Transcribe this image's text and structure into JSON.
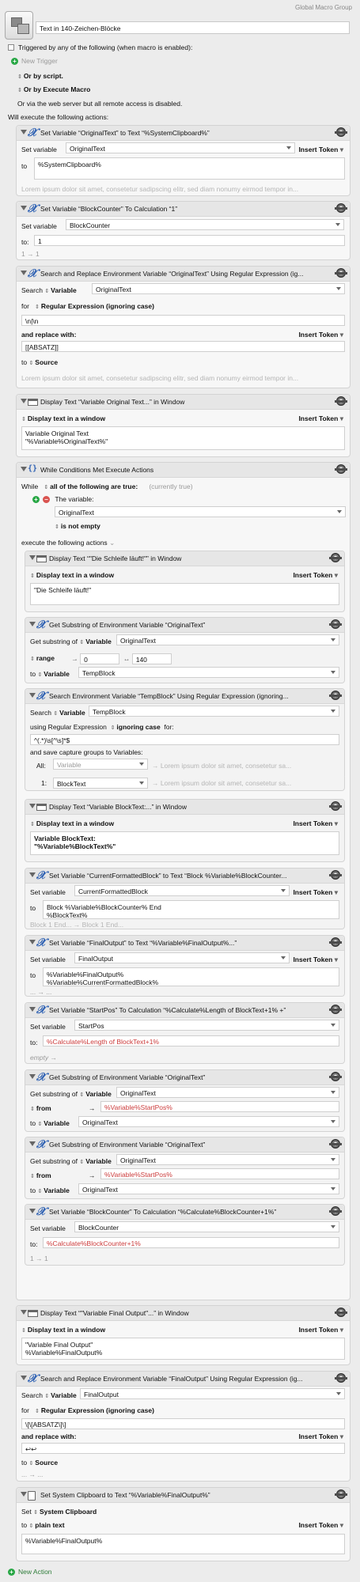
{
  "header": {
    "group_name": "Global Macro Group",
    "macro_name": "Text in 140-Zeichen-Blöcke",
    "triggered_label": "Triggered by any of the following (when macro is enabled):",
    "new_trigger_label": "New Trigger",
    "or_by_script": "Or by script.",
    "or_by_execute_macro": "Or by Execute Macro",
    "web_server_note": "Or via the web server but all remote access is disabled.",
    "will_execute": "Will execute the following actions:"
  },
  "common": {
    "insert_token": "Insert Token",
    "lorem": "Lorem ipsum dolor sit amet, consetetur sadipscing elitr, sed diam nonumy eirmod tempor in...",
    "lorem_short": "Lorem ipsum dolor sit amet, consetetur sa...",
    "set_variable": "Set variable",
    "to": "to",
    "to_colon": "to:",
    "arrow": "→",
    "display_in_window": "Display text in a window"
  },
  "actions": {
    "a1": {
      "title": "Set Variable “OriginalText” to Text “%SystemClipboard%”",
      "variable": "OriginalText",
      "text": "%SystemClipboard%"
    },
    "a2": {
      "title": "Set Variable “BlockCounter” To Calculation “1”",
      "variable": "BlockCounter",
      "value": "1",
      "result": "1 → 1"
    },
    "a3": {
      "title": "Search and Replace Environment Variable “OriginalText” Using Regular Expression (ig...",
      "search_label": "Search",
      "variable_label": "Variable",
      "variable": "OriginalText",
      "for_label": "for",
      "mode": "Regular Expression (ignoring case)",
      "pattern": "\\n|\\n",
      "replace_label": "and replace with:",
      "replacement": "[[ABSATZ]]",
      "to_label": "to",
      "to_value": "Source"
    },
    "a4": {
      "title": "Display Text “Variable Original Text...” in Window",
      "text": "Variable Original Text\n\"%Variable%OriginalText%\""
    },
    "a5": {
      "title": "While Conditions Met Execute Actions",
      "while": "While",
      "all_label": "all of the following are true:",
      "currently": "(currently true)",
      "the_variable": "The variable:",
      "variable": "OriginalText",
      "condition": "is not empty",
      "execute": "execute the following actions"
    },
    "a5_1": {
      "title": "Display Text “\"Die Schleife läuft!\"” in Window",
      "text": "\"Die Schleife läuft!\""
    },
    "a5_2": {
      "title": "Get Substring of Environment Variable “OriginalText”",
      "get_label": "Get substring of",
      "variable_label": "Variable",
      "variable": "OriginalText",
      "range_label": "range",
      "from_value": "0",
      "len_value": "140",
      "to_variable": "TempBlock"
    },
    "a5_3": {
      "title": "Search Environment Variable “TempBlock” Using Regular Expression (ignoring...",
      "search_label": "Search",
      "variable_label": "Variable",
      "variable": "TempBlock",
      "using": "using Regular Expression",
      "ignoring": "ignoring case",
      "for_label": "for:",
      "pattern": "^(.*)\\s[^\\s]*$",
      "save_label": "and save capture groups to Variables:",
      "all_label": "All:",
      "all_placeholder": "Variable",
      "one_label": "1:",
      "one_value": "BlockText"
    },
    "a5_4": {
      "title": "Display Text “Variable BlockText:...” in Window",
      "text": "Variable BlockText:\n\"%Variable%BlockText%\""
    },
    "a5_5": {
      "title": "Set Variable “CurrentFormattedBlock” to Text “Block %Variable%BlockCounter...",
      "variable": "CurrentFormattedBlock",
      "text": "Block %Variable%BlockCounter% End\n%BlockText%",
      "result": "Block 1 End... → Block 1 End..."
    },
    "a5_6": {
      "title": "Set Variable “FinalOutput” to Text “%Variable%FinalOutput%...”",
      "variable": "FinalOutput",
      "text": "%Variable%FinalOutput%\n%Variable%CurrentFormattedBlock%",
      "result": "... → ..."
    },
    "a5_7": {
      "title": "Set Variable “StartPos” To Calculation “%Calculate%Length of BlockText+1% +”",
      "variable": "StartPos",
      "value": "%Calculate%Length of BlockText+1%",
      "result": "empty →"
    },
    "a5_8": {
      "title": "Get Substring of Environment Variable “OriginalText”",
      "get_label": "Get substring of",
      "variable_label": "Variable",
      "variable": "OriginalText",
      "from_label": "from",
      "from_value": "%Variable%StartPos%",
      "to_variable": "OriginalText"
    },
    "a5_9": {
      "title": "Get Substring of Environment Variable “OriginalText”",
      "get_label": "Get substring of",
      "variable_label": "Variable",
      "variable": "OriginalText",
      "from_label": "from",
      "from_value": "%Variable%StartPos%",
      "to_variable": "OriginalText"
    },
    "a5_10": {
      "title": "Set Variable “BlockCounter” To Calculation “%Calculate%BlockCounter+1%”",
      "variable": "BlockCounter",
      "value": "%Calculate%BlockCounter+1%",
      "result": "1 → 1"
    },
    "a6": {
      "title": "Display Text “\"Variable Final Output\"...” in Window",
      "text": "\"Variable Final Output\"\n%Variable%FinalOutput%"
    },
    "a7": {
      "title": "Search and Replace Environment Variable “FinalOutput” Using Regular Expression (ig...",
      "search_label": "Search",
      "variable_label": "Variable",
      "variable": "FinalOutput",
      "for_label": "for",
      "mode": "Regular Expression (ignoring case)",
      "pattern": "\\[\\[ABSATZ\\]\\]",
      "replace_label": "and replace with:",
      "replacement": "↩↩",
      "to_label": "to",
      "to_value": "Source",
      "result": "... → ..."
    },
    "a8": {
      "title": "Set System Clipboard to Text “%Variable%FinalOutput%”",
      "set_label": "Set",
      "target": "System Clipboard",
      "to_label": "to",
      "mode": "plain text",
      "text": "%Variable%FinalOutput%"
    }
  },
  "footer": {
    "new_action": "New Action"
  }
}
